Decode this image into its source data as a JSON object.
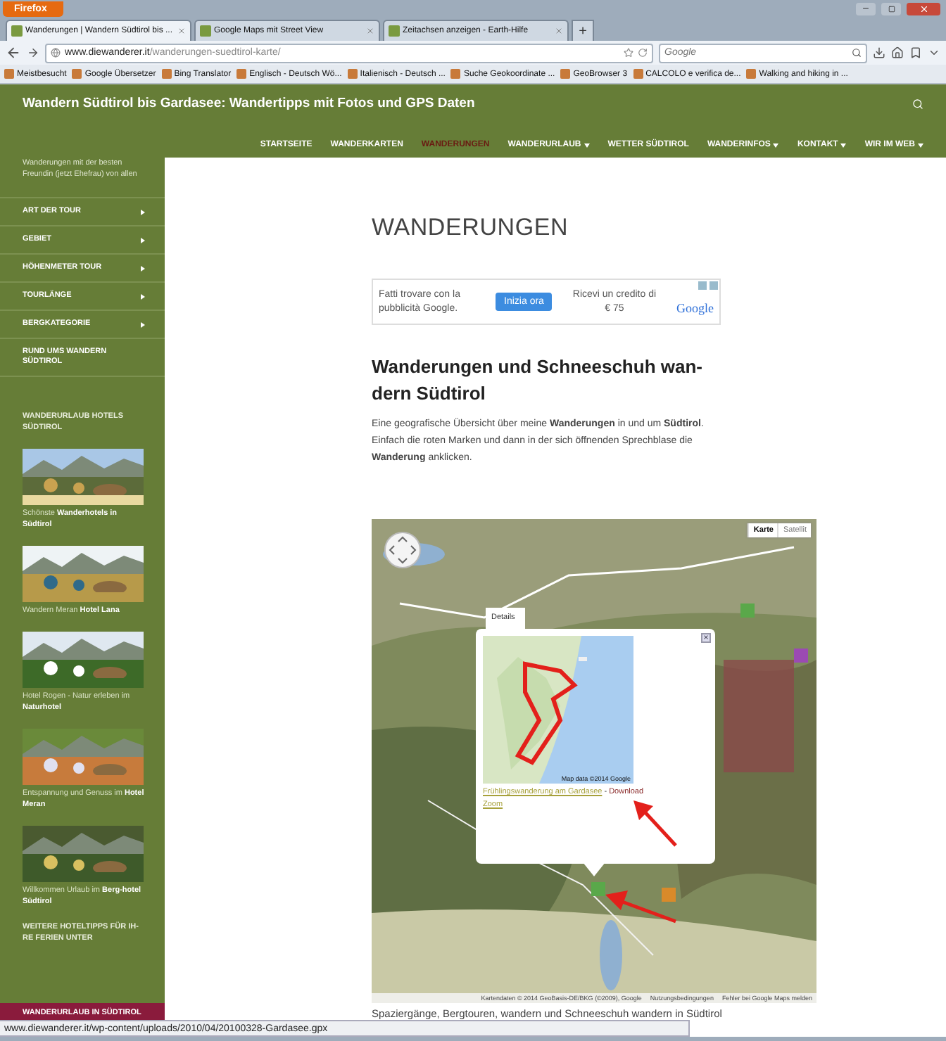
{
  "browser": {
    "app_button": "Firefox",
    "tabs": [
      {
        "title": "Wanderungen | Wandern Südtirol bis ...",
        "selected": true
      },
      {
        "title": "Google Maps mit Street View",
        "selected": false
      },
      {
        "title": "Zeitachsen anzeigen - Earth-Hilfe",
        "selected": false
      }
    ],
    "new_tab": "+",
    "url": {
      "domain": "www.diewanderer.it",
      "path": "/wanderungen-suedtirol-karte/"
    },
    "search": {
      "placeholder": "Google"
    },
    "bookmarks": [
      "Meistbesucht",
      "Google Übersetzer",
      "Bing Translator",
      "Englisch - Deutsch Wö...",
      "Italienisch - Deutsch ...",
      "Suche Geokoordinate ...",
      "GeoBrowser 3",
      "CALCOLO e verifica de...",
      "Walking and hiking in ..."
    ]
  },
  "site": {
    "title": "Wandern Südtirol bis Gardasee: Wandertipps mit Fotos und GPS Daten",
    "nav": [
      {
        "label": "STARTSEITE",
        "selected": false,
        "has_menu": false
      },
      {
        "label": "WANDERKARTEN",
        "selected": false,
        "has_menu": false
      },
      {
        "label": "WANDERUNGEN",
        "selected": true,
        "has_menu": false
      },
      {
        "label": "WANDERURLAUB",
        "selected": false,
        "has_menu": true
      },
      {
        "label": "WETTER SÜDTIROL",
        "selected": false,
        "has_menu": false
      },
      {
        "label": "WANDERINFOS",
        "selected": false,
        "has_menu": true
      },
      {
        "label": "KONTAKT",
        "selected": false,
        "has_menu": true
      },
      {
        "label": "WIR IM WEB",
        "selected": false,
        "has_menu": true
      }
    ]
  },
  "sidebar": {
    "intro": "Wanderungen mit der besten Freundin (jetzt Ehefrau) von allen",
    "menu": [
      {
        "label": "ART DER TOUR",
        "has_submenu": true
      },
      {
        "label": "GEBIET",
        "has_submenu": true
      },
      {
        "label": "HÖHENMETER TOUR",
        "has_submenu": true
      },
      {
        "label": "TOURLÄNGE",
        "has_submenu": true
      },
      {
        "label": "BERGKATEGORIE",
        "has_submenu": true
      },
      {
        "label": "RUND UMS WANDERN SÜDTIROL",
        "has_submenu": false
      }
    ],
    "section_title": "WANDERURLAUB HOTELS SÜDTIROL",
    "hotels": [
      {
        "caption": "Schönste **Wanderhotels in Südtirol**"
      },
      {
        "caption": "Wandern Meran **Hotel Lana**"
      },
      {
        "caption": "Hotel Rogen - Natur erleben im **Naturhotel**"
      },
      {
        "caption": "Entspannung und Genuss im **Hotel Meran**"
      },
      {
        "caption": "Willkommen Urlaub im **Berg-hotel Südtirol**"
      }
    ],
    "more_title": "WEITERE HOTELTIPPS FÜR IH-RE FERIEN UNTER",
    "bottom_item": "WANDERURLAUB IN SÜDTIROL"
  },
  "content": {
    "heading": "WANDERUNGEN",
    "ad": {
      "left_text": "Fatti trovare con la pubblicità Google.",
      "button": "Inizia ora",
      "right_text": "Ricevi un credito di € 75",
      "brand": "Google"
    },
    "subheading": "Wanderungen und Schneeschuh wan-dern Südtirol",
    "paragraph": "Eine geografische Übersicht über meine **Wanderungen** in und um **Südtirol**. Einfach die roten Marken und dann in der sich öffnenden Sprechblase die **Wanderung** anklicken.",
    "map": {
      "map_types": [
        {
          "label": "Karte",
          "selected": true
        },
        {
          "label": "Satellit",
          "selected": false
        }
      ],
      "popup": {
        "tab": "Details",
        "close": "×",
        "thumb_attribution": "Map data ©2014 Google",
        "link": "Frühlingswanderung am Gardasee",
        "separator": " - ",
        "download": "Download",
        "zoom": "Zoom"
      },
      "attribution": [
        "Kartendaten © 2014 GeoBasis-DE/BKG (©2009), Google",
        "Nutzungsbedingungen",
        "Fehler bei Google Maps melden"
      ]
    },
    "caption": "Spaziergänge, Bergtouren, wandern und Schneeschuh wandern in Südtirol"
  },
  "status_bar": "www.diewanderer.it/wp-content/uploads/2010/04/20100328-Gardasee.gpx"
}
